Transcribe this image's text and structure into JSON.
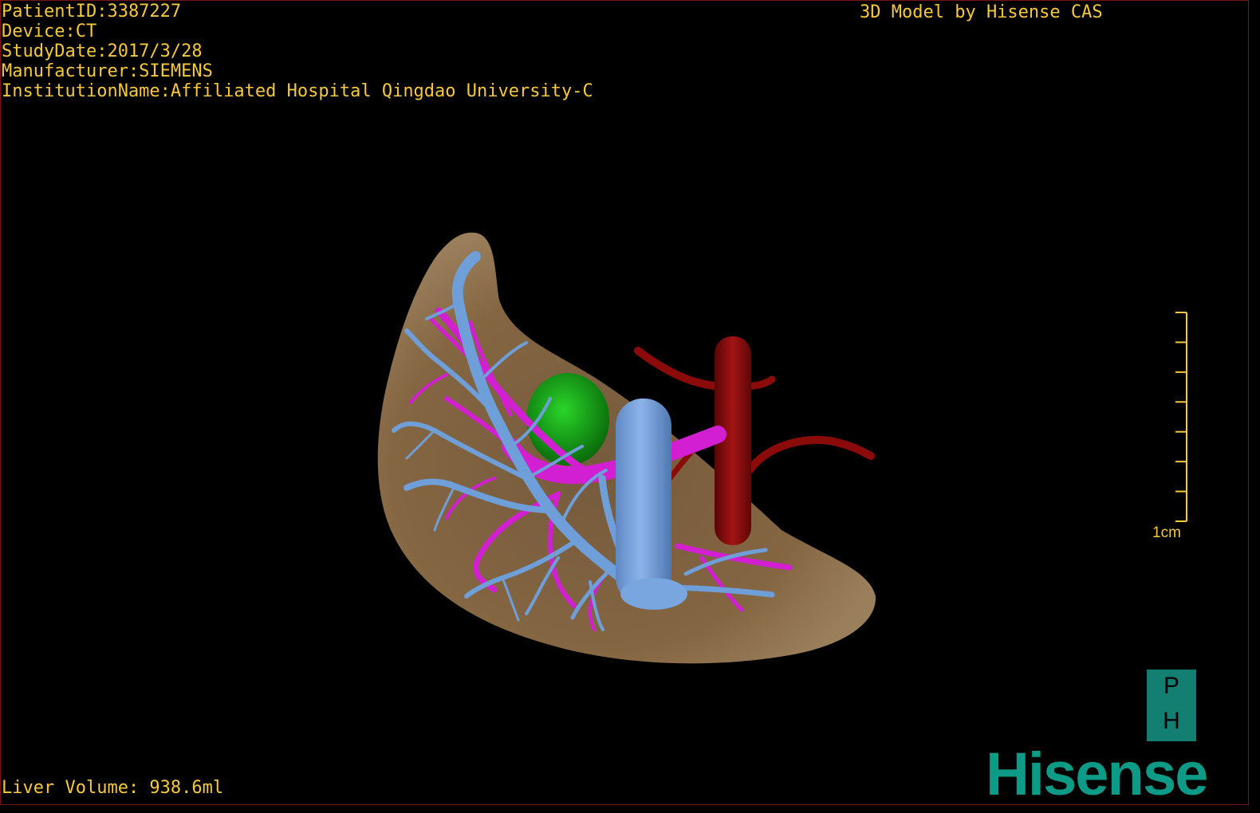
{
  "study_info": {
    "patient_id": "PatientID:3387227",
    "device": "Device:CT",
    "study_date": "StudyDate:2017/3/28",
    "manufacturer": "Manufacturer:SIEMENS",
    "institution": "InstitutionName:Affiliated Hospital Qingdao University-C"
  },
  "credit": "3D Model by Hisense CAS",
  "liver_volume": "Liver Volume: 938.6ml",
  "scale_bar": {
    "label": "1cm",
    "tick_count": 8
  },
  "orientation_cube": {
    "top": "P",
    "bottom": "H"
  },
  "brand_logo": "Hisense",
  "colors": {
    "text": "#f5c93a",
    "liver": "#8a6a45",
    "hepatic_vein": "#6f9fd8",
    "portal_vein": "#d21fd2",
    "artery": "#8b0b0b",
    "gallbladder": "#0f9a12",
    "brand": "#0d9a86"
  }
}
